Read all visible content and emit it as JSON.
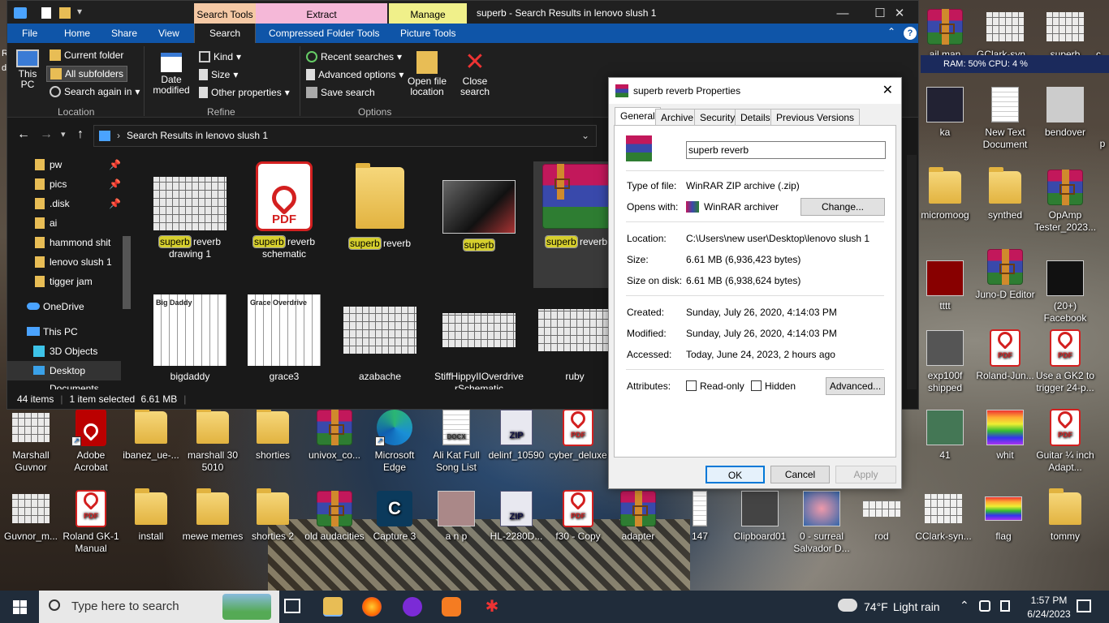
{
  "explorer": {
    "context_tabs": [
      "Search Tools",
      "Extract",
      "Manage"
    ],
    "title": "superb - Search Results in lenovo slush 1",
    "ribbon_tabs": [
      "File",
      "Home",
      "Share",
      "View",
      "Search",
      "Compressed Folder Tools",
      "Picture Tools"
    ],
    "ribbon": {
      "this_pc": "This PC",
      "current_folder": "Current folder",
      "all_subfolders": "All subfolders",
      "search_again": "Search again in",
      "location": "Location",
      "date_modified": "Date modified",
      "kind": "Kind",
      "size": "Size",
      "other_properties": "Other properties",
      "refine": "Refine",
      "recent_searches": "Recent searches",
      "advanced_options": "Advanced options",
      "save_search": "Save search",
      "options": "Options",
      "open_file_location": "Open file location",
      "close_search": "Close search"
    },
    "address": "Search Results in lenovo slush 1",
    "nav": [
      {
        "label": "pw",
        "pinned": true
      },
      {
        "label": "pics",
        "pinned": true
      },
      {
        "label": ".disk",
        "pinned": true
      },
      {
        "label": "ai"
      },
      {
        "label": "hammond shit"
      },
      {
        "label": "lenovo slush 1"
      },
      {
        "label": "tigger jam"
      },
      {
        "label": "OneDrive"
      },
      {
        "label": "This PC"
      },
      {
        "label": "3D Objects"
      },
      {
        "label": "Desktop"
      },
      {
        "label": "Documents"
      }
    ],
    "files_row1": [
      {
        "hl": "superb",
        "rest": "reverb",
        "line2": "drawing 1"
      },
      {
        "hl": "superb",
        "rest": "reverb",
        "line2": "schematic"
      },
      {
        "hl": "superb",
        "rest": "reverb",
        "line2": ""
      },
      {
        "hl": "superb",
        "rest": "",
        "line2": ""
      },
      {
        "hl": "superb",
        "rest": "reverb",
        "line2": ""
      }
    ],
    "files_row2": [
      "bigdaddy",
      "grace3",
      "azabache",
      "StiffHippyIIOverdriverSchematic",
      "ruby"
    ],
    "thumb_labels": {
      "pdf": "PDF",
      "bigdaddy": "Big Daddy",
      "grace": "Grace Overdrive"
    },
    "status": {
      "items": "44 items",
      "selected": "1 item selected",
      "size": "6.61 MB"
    }
  },
  "props": {
    "title": "superb reverb Properties",
    "tabs": [
      "General",
      "Archive",
      "Security",
      "Details",
      "Previous Versions"
    ],
    "name": "superb reverb",
    "rows": [
      {
        "label": "Type of file:",
        "value": "WinRAR ZIP archive (.zip)"
      },
      {
        "label": "Opens with:",
        "value": "WinRAR archiver"
      },
      {
        "label": "Location:",
        "value": "C:\\Users\\new user\\Desktop\\lenovo slush 1"
      },
      {
        "label": "Size:",
        "value": "6.61 MB (6,936,423 bytes)"
      },
      {
        "label": "Size on disk:",
        "value": "6.61 MB (6,938,624 bytes)"
      },
      {
        "label": "Created:",
        "value": "Sunday, July 26, 2020, 4:14:03 PM"
      },
      {
        "label": "Modified:",
        "value": "Sunday, July 26, 2020, 4:14:03 PM"
      },
      {
        "label": "Accessed:",
        "value": "Today, June 24, 2023, 2 hours ago"
      }
    ],
    "attributes": "Attributes:",
    "readonly": "Read-only",
    "hidden": "Hidden",
    "change": "Change...",
    "advanced": "Advanced...",
    "ok": "OK",
    "cancel": "Cancel",
    "apply": "Apply"
  },
  "perf": "RAM: 50%   CPU: 4 %",
  "desktop": {
    "right": [
      [
        "ail man",
        "GClark-syn...",
        "superb",
        "c"
      ],
      [
        "ka",
        "New Text Document",
        "bendover",
        "p"
      ],
      [
        "micromoog",
        "synthed",
        "OpAmp Tester_2023..."
      ],
      [
        "tttt",
        "Juno-D Editor",
        "(20+) Facebook"
      ],
      [
        "exp100f shipped",
        "Roland-Jun...",
        "Use a GK2 to trigger 24-p..."
      ],
      [
        "41",
        "whit",
        "Guitar ¼ inch Adapt..."
      ]
    ],
    "row1": [
      "Marshall Guvnor",
      "Adobe Acrobat",
      "ibanez_ue-...",
      "marshall 30 5010",
      "shorties",
      "univox_co...",
      "Microsoft Edge",
      "Ali Kat Full Song List",
      "delinf_10590",
      "cyber_deluxe"
    ],
    "row2": [
      "Guvnor_m...",
      "Roland GK-1 Manual",
      "install",
      "mewe memes",
      "shorties 2",
      "old audacities",
      "Capture 3",
      "a n p",
      "HL-2280D...",
      "f30 - Copy",
      "adapter",
      "147",
      "Clipboard01",
      "0 - surreal Salvador D...",
      "rod",
      "CClark-syn...",
      "flag",
      "tommy"
    ],
    "docx": "DOCX",
    "zip": "ZIP",
    "left_edge": [
      "R",
      "d"
    ]
  },
  "taskbar": {
    "search": "Type here to search",
    "weather_temp": "74°F",
    "weather_text": "Light rain",
    "time": "1:57 PM",
    "date": "6/24/2023"
  }
}
